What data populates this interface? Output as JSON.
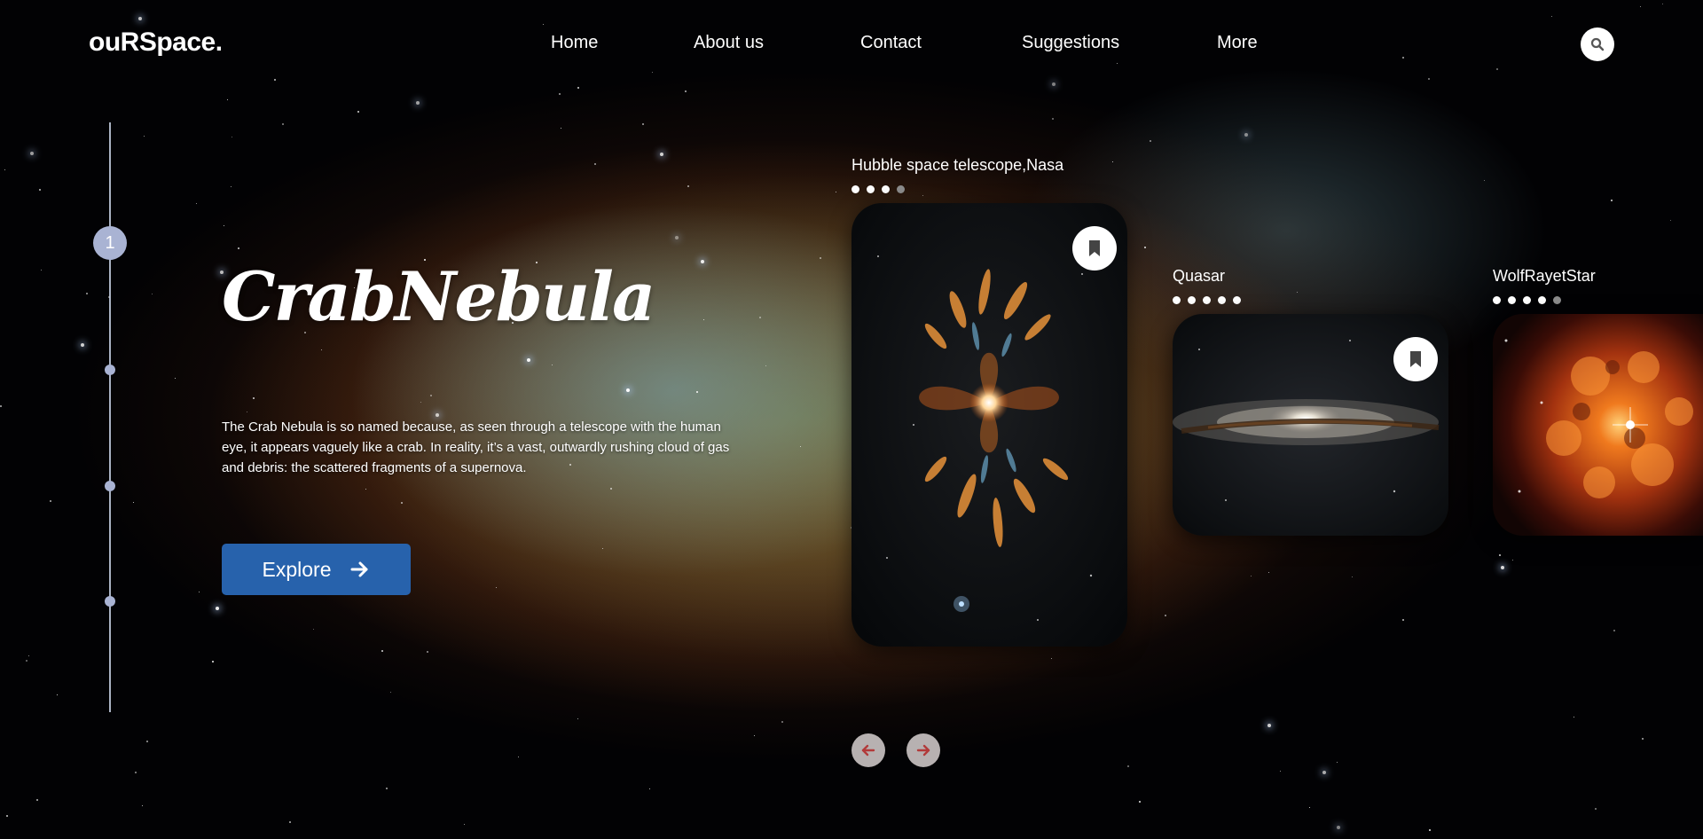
{
  "brand": {
    "logo": "ouRSpace."
  },
  "nav": {
    "items": [
      {
        "label": "Home"
      },
      {
        "label": "About us"
      },
      {
        "label": "Contact"
      },
      {
        "label": "Suggestions"
      },
      {
        "label": "More"
      }
    ],
    "search_icon": "search-icon"
  },
  "pager": {
    "current": "1",
    "total_dots": 3
  },
  "hero": {
    "title": "CrabNebula",
    "description": "The Crab Nebula is so named because, as seen through a telescope with the human eye, it appears vaguely like a crab. In reality, it’s a vast, outwardly rushing cloud of gas and debris: the scattered fragments of a supernova.",
    "cta_label": "Explore",
    "cta_icon": "arrow-right-icon"
  },
  "cards": [
    {
      "label": "Hubble space telescope,Nasa",
      "dots_filled": 3,
      "dots_total": 4,
      "image": "butterfly-nebula",
      "bookmark": true
    },
    {
      "label": "Quasar",
      "dots_filled": 5,
      "dots_total": 5,
      "image": "spiral-galaxy",
      "bookmark": true
    },
    {
      "label": "WolfRayetStar",
      "dots_filled": 4,
      "dots_total": 5,
      "image": "wolf-rayet-star",
      "bookmark": false
    }
  ],
  "carousel": {
    "prev_icon": "arrow-left-icon",
    "next_icon": "arrow-right-icon"
  },
  "colors": {
    "accent": "#2762ac",
    "pager": "#a9b3d3",
    "arrow_button": "#b7b1b1",
    "arrow_icon": "#b23a3a"
  }
}
